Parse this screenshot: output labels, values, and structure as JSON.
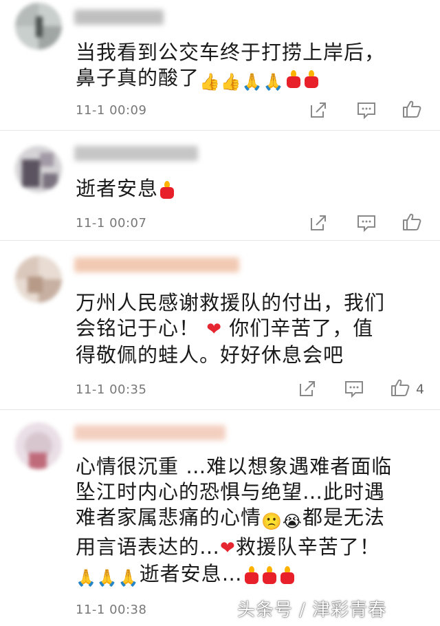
{
  "comments": [
    {
      "text_line1": "当我看到公交车终于打捞上岸后，",
      "text_line2": "鼻子真的酸了",
      "time": "11-1 00:09",
      "likes": ""
    },
    {
      "text_line1": "逝者安息",
      "time": "11-1 00:07",
      "likes": ""
    },
    {
      "text_line1": "万州人民感谢救援队的付出，我们",
      "text_line2a": "会铭记于心！",
      "text_line2b": "你们辛苦了，值",
      "text_line3": "得敬佩的蛙人。好好休息会吧",
      "time": "11-1 00:35",
      "likes": "4"
    },
    {
      "text_line1": "心情很沉重 …难以想象遇难者面临",
      "text_line2": "坠江时内心的恐惧与绝望…此时遇",
      "text_line3a": "难者家属悲痛的心情",
      "text_line3b": "都是无法",
      "text_line4a": "用言语表达的…",
      "text_line4b": "救援队辛苦了！",
      "text_line5": "逝者安息…",
      "time": "11-1 00:38",
      "likes": ""
    }
  ],
  "watermark": "头条号 / 津彩青春",
  "icons": [
    "share-icon",
    "comment-icon",
    "like-icon"
  ],
  "colors": {
    "candle": "#e8202a",
    "heart": "#e5252f",
    "meta": "#777777"
  }
}
